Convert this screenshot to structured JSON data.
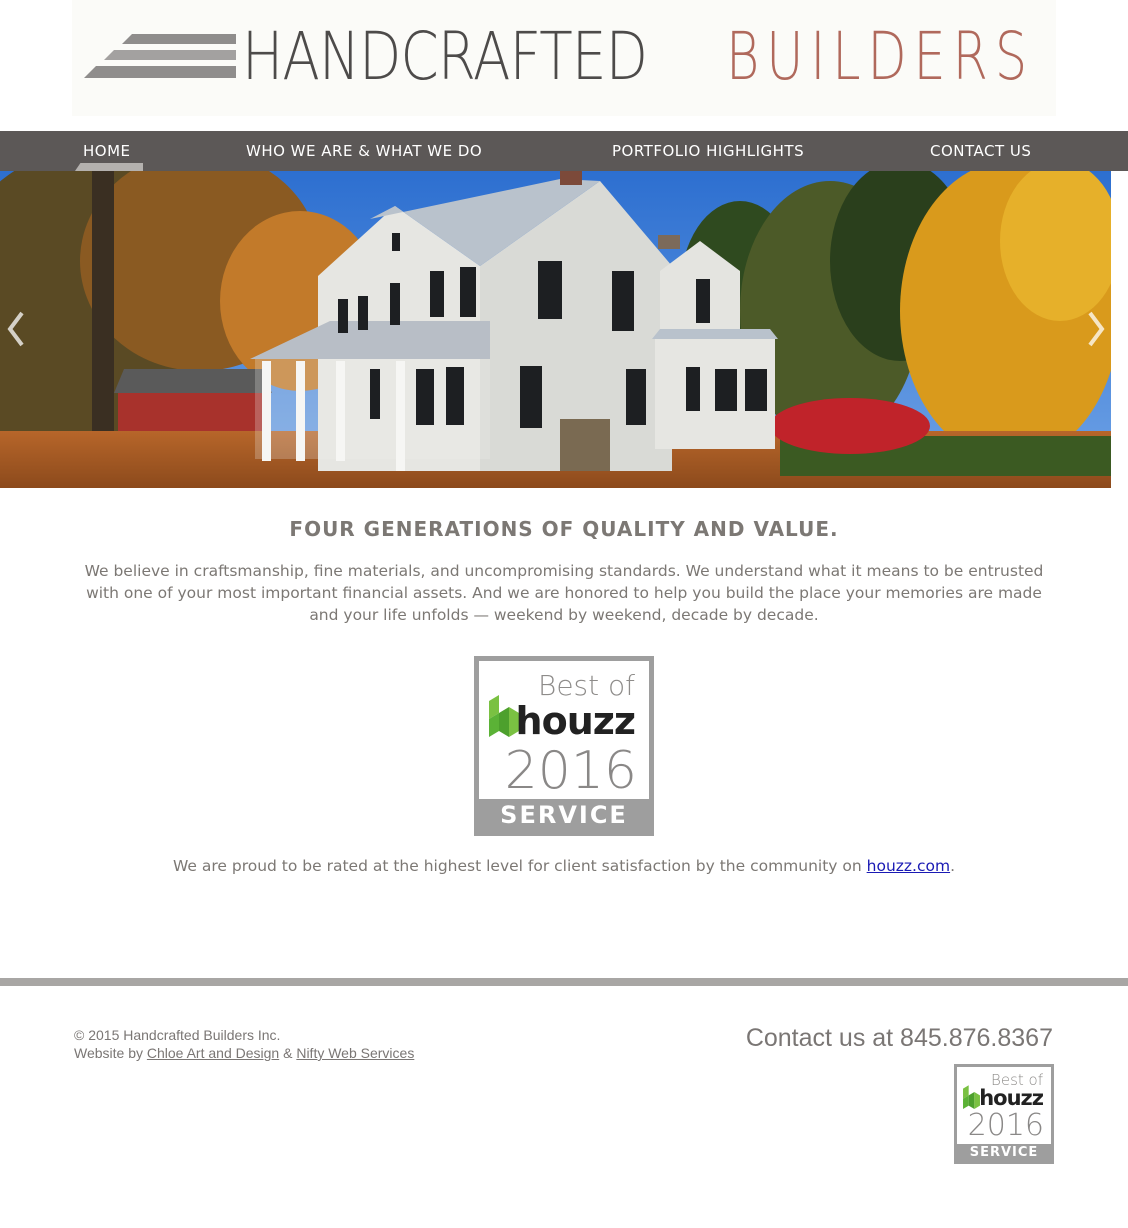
{
  "header": {
    "logo_word_1": "HANDCRAFTED",
    "logo_word_2": "BUILDERS"
  },
  "nav": {
    "items": [
      {
        "label": "HOME",
        "active": true
      },
      {
        "label": "WHO WE ARE & WHAT WE DO",
        "active": false
      },
      {
        "label": "PORTFOLIO HIGHLIGHTS",
        "active": false
      },
      {
        "label": "CONTACT US",
        "active": false
      }
    ]
  },
  "hero": {
    "prev_icon": "chevron-left-icon",
    "next_icon": "chevron-right-icon"
  },
  "main": {
    "headline": "FOUR GENERATIONS OF QUALITY AND VALUE.",
    "intro": "We believe in craftsmanship, fine materials, and uncompromising standards. We understand what it means to be entrusted with one of your most important financial assets. And we are honored to help you build the place your memories are made and your life unfolds — weekend by weekend, decade by decade.",
    "badge": {
      "best_of": "Best of",
      "brand": "houzz",
      "year": "2016",
      "category": "SERVICE"
    },
    "houzz_note_prefix": "We are proud to be rated at the highest level for client satisfaction by the community on ",
    "houzz_link": "houzz.com",
    "houzz_note_suffix": "."
  },
  "footer": {
    "copyright": "© 2015 Handcrafted Builders Inc.",
    "credit_prefix": "Website by ",
    "credit_link_1": "Chloe Art and Design",
    "credit_join": " & ",
    "credit_link_2": "Nifty Web Services",
    "contact": "Contact us at 845.876.8367"
  },
  "colors": {
    "nav_bg": "#5c5857",
    "logo_dark": "#4d4b4a",
    "logo_accent": "#b0695c",
    "houzz_green": "#7ac142",
    "footer_rule": "#a8a6a4"
  }
}
